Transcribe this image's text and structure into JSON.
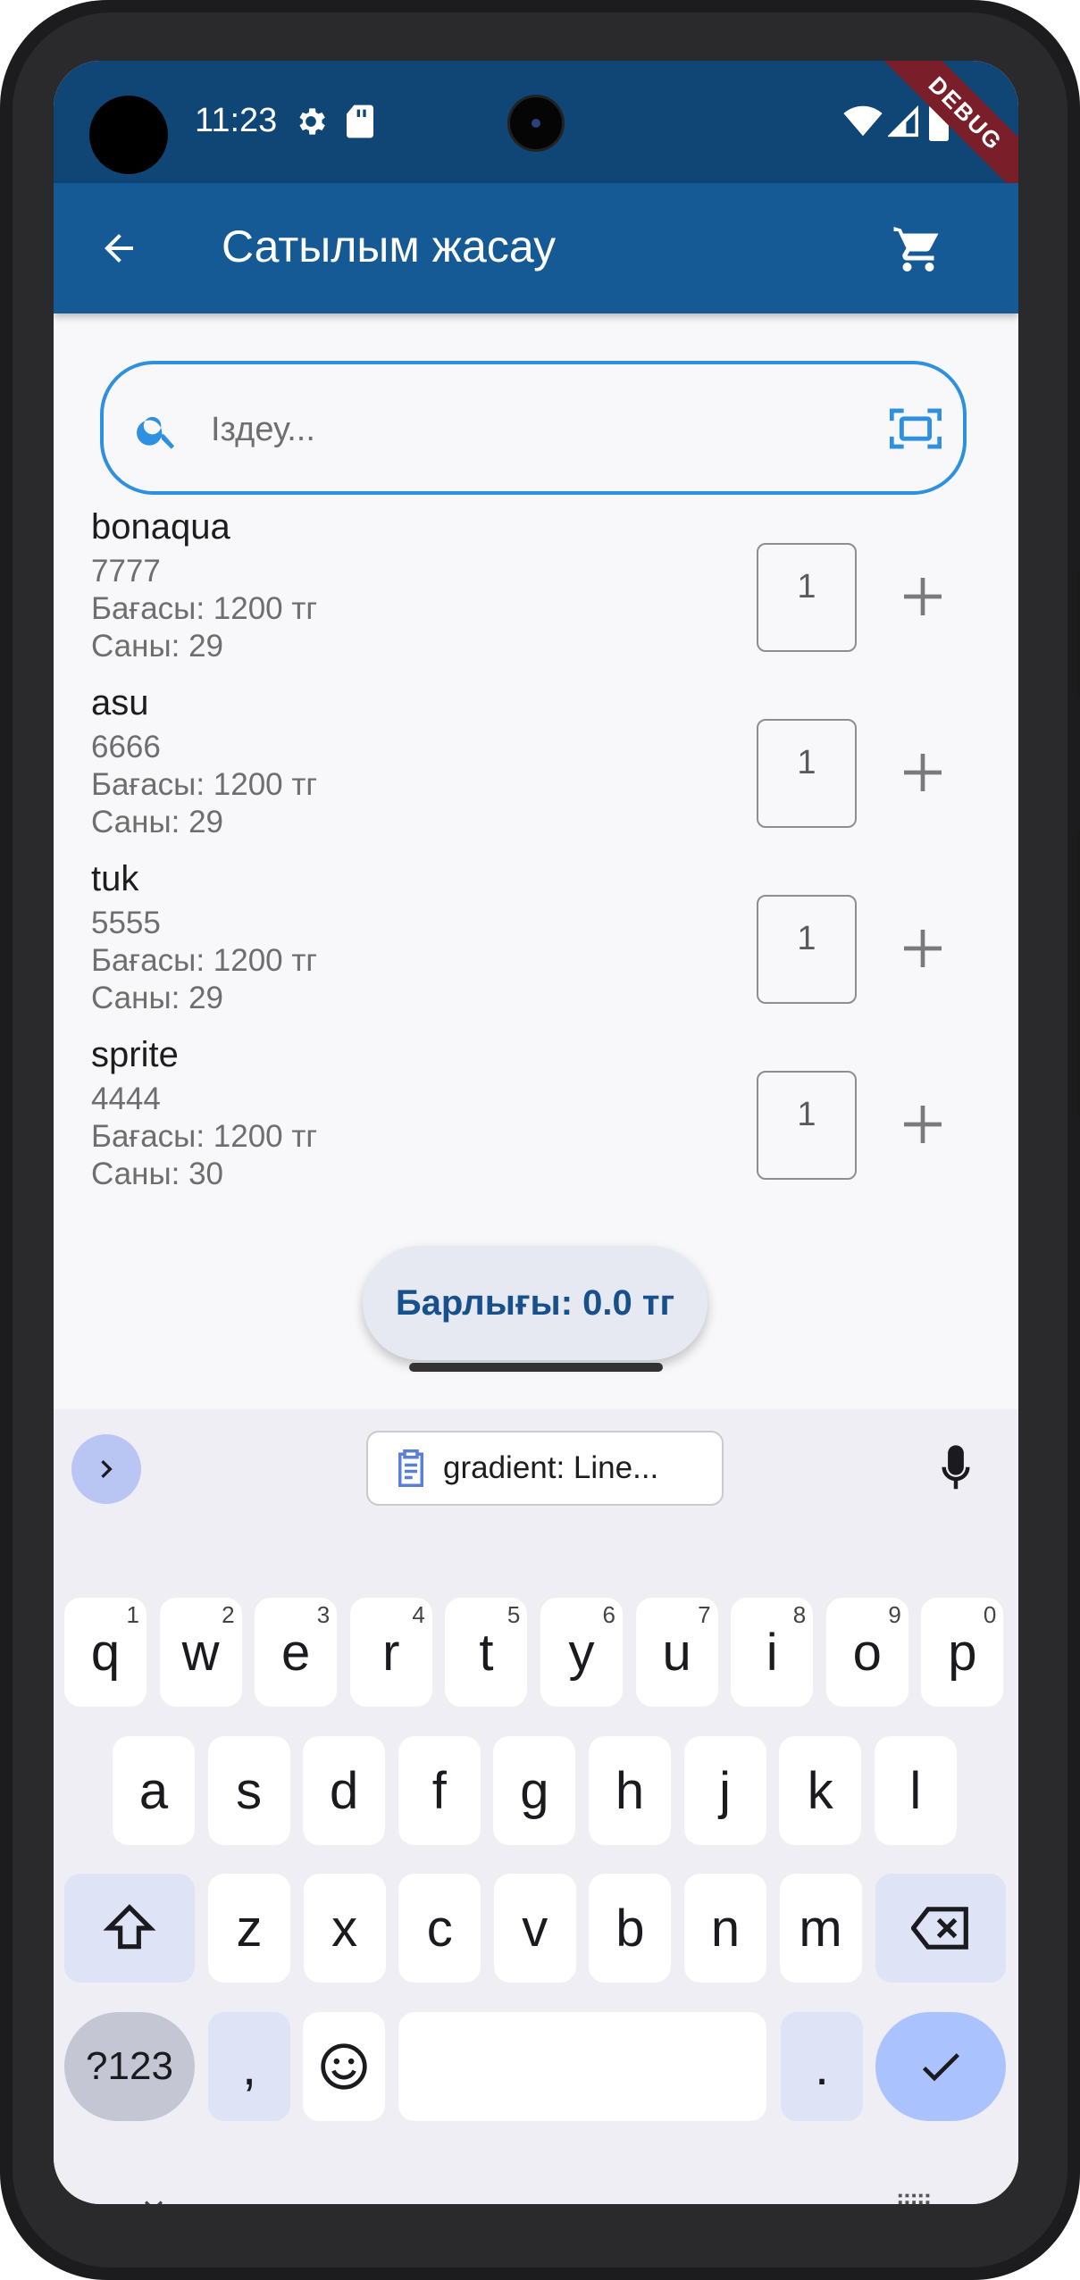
{
  "status_bar": {
    "time": "11:23",
    "icons": [
      "settings-icon",
      "sd-card-icon",
      "wifi-icon",
      "signal-icon",
      "battery-icon"
    ],
    "debug_banner": "DEBUG",
    "colors": {
      "background": "#0f4676"
    }
  },
  "app_bar": {
    "title": "Сатылым жасау",
    "back_icon": "arrow-left-icon",
    "cart_icon": "cart-icon",
    "colors": {
      "background": "#155a94",
      "text": "#ffffff"
    }
  },
  "search": {
    "placeholder": "Іздеу...",
    "value": "",
    "icons": [
      "search-icon",
      "barcode-scan-icon"
    ],
    "colors": {
      "border": "#2e90e0"
    }
  },
  "products": [
    {
      "name": "bonaqua",
      "code": "7777",
      "price": "Бағасы: 1200 тг",
      "stock": "Саны: 29",
      "quantity": "1"
    },
    {
      "name": "asu",
      "code": "6666",
      "price": "Бағасы: 1200 тг",
      "stock": "Саны: 29",
      "quantity": "1"
    },
    {
      "name": "tuk",
      "code": "5555",
      "price": "Бағасы: 1200 тг",
      "stock": "Саны: 29",
      "quantity": "1"
    },
    {
      "name": "sprite",
      "code": "4444",
      "price": "Бағасы: 1200 тг",
      "stock": "Саны: 30",
      "quantity": "1"
    }
  ],
  "total": {
    "label": "Барлығы: 0.0 тг",
    "colors": {
      "text": "#17508a"
    }
  },
  "keyboard": {
    "clipboard_chip": "gradient: Line...",
    "row1": [
      {
        "k": "q",
        "h": "1"
      },
      {
        "k": "w",
        "h": "2"
      },
      {
        "k": "e",
        "h": "3"
      },
      {
        "k": "r",
        "h": "4"
      },
      {
        "k": "t",
        "h": "5"
      },
      {
        "k": "y",
        "h": "6"
      },
      {
        "k": "u",
        "h": "7"
      },
      {
        "k": "i",
        "h": "8"
      },
      {
        "k": "o",
        "h": "9"
      },
      {
        "k": "p",
        "h": "0"
      }
    ],
    "row2": [
      "a",
      "s",
      "d",
      "f",
      "g",
      "h",
      "j",
      "k",
      "l"
    ],
    "row3": [
      "z",
      "x",
      "c",
      "v",
      "b",
      "n",
      "m"
    ],
    "symbols_key": "?123",
    "comma_key": ",",
    "period_key": ".",
    "icons": [
      "chevron-right-icon",
      "clipboard-icon",
      "mic-icon",
      "shift-icon",
      "backspace-icon",
      "emoji-icon",
      "check-icon",
      "chevron-down-icon",
      "keyboard-icon"
    ]
  }
}
